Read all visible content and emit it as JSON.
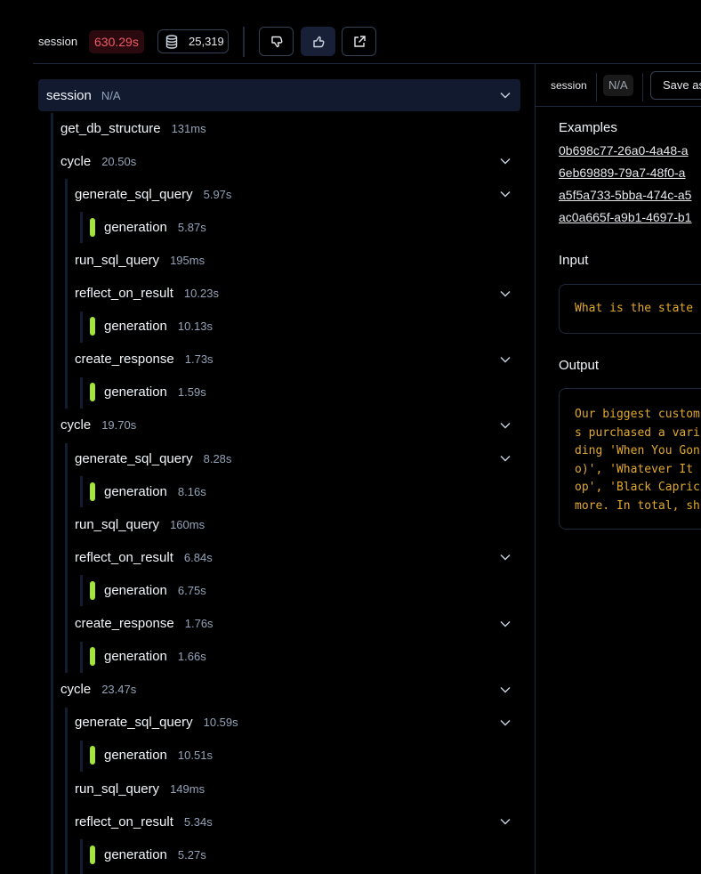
{
  "topbar": {
    "label": "session",
    "latency": "630.29s",
    "tokens": "25,319",
    "buttons": [
      {
        "icon": "thumbs-down-icon",
        "active": false
      },
      {
        "icon": "thumbs-up-icon",
        "active": true
      },
      {
        "icon": "external-link-icon",
        "active": false
      }
    ]
  },
  "colors": {
    "latency_text": "#f05a66",
    "generation_marker": "#a3e635",
    "code_text": "#e0a82e",
    "selected_row_bg": "#111a2e"
  },
  "tree": {
    "root": {
      "name": "session",
      "duration": "N/A"
    },
    "nodes": [
      {
        "name": "get_db_structure",
        "duration": "131ms",
        "level": 1,
        "expandable": false
      },
      {
        "name": "cycle",
        "duration": "20.50s",
        "level": 1,
        "expandable": true
      },
      {
        "name": "generate_sql_query",
        "duration": "5.97s",
        "level": 2,
        "expandable": true
      },
      {
        "name": "generation",
        "duration": "5.87s",
        "level": 3,
        "generation": true
      },
      {
        "name": "run_sql_query",
        "duration": "195ms",
        "level": 2,
        "expandable": false
      },
      {
        "name": "reflect_on_result",
        "duration": "10.23s",
        "level": 2,
        "expandable": true
      },
      {
        "name": "generation",
        "duration": "10.13s",
        "level": 3,
        "generation": true
      },
      {
        "name": "create_response",
        "duration": "1.73s",
        "level": 2,
        "expandable": true
      },
      {
        "name": "generation",
        "duration": "1.59s",
        "level": 3,
        "generation": true
      },
      {
        "name": "cycle",
        "duration": "19.70s",
        "level": 1,
        "expandable": true
      },
      {
        "name": "generate_sql_query",
        "duration": "8.28s",
        "level": 2,
        "expandable": true
      },
      {
        "name": "generation",
        "duration": "8.16s",
        "level": 3,
        "generation": true
      },
      {
        "name": "run_sql_query",
        "duration": "160ms",
        "level": 2,
        "expandable": false
      },
      {
        "name": "reflect_on_result",
        "duration": "6.84s",
        "level": 2,
        "expandable": true
      },
      {
        "name": "generation",
        "duration": "6.75s",
        "level": 3,
        "generation": true
      },
      {
        "name": "create_response",
        "duration": "1.76s",
        "level": 2,
        "expandable": true
      },
      {
        "name": "generation",
        "duration": "1.66s",
        "level": 3,
        "generation": true
      },
      {
        "name": "cycle",
        "duration": "23.47s",
        "level": 1,
        "expandable": true
      },
      {
        "name": "generate_sql_query",
        "duration": "10.59s",
        "level": 2,
        "expandable": true
      },
      {
        "name": "generation",
        "duration": "10.51s",
        "level": 3,
        "generation": true
      },
      {
        "name": "run_sql_query",
        "duration": "149ms",
        "level": 2,
        "expandable": false
      },
      {
        "name": "reflect_on_result",
        "duration": "5.34s",
        "level": 2,
        "expandable": true
      },
      {
        "name": "generation",
        "duration": "5.27s",
        "level": 3,
        "generation": true
      }
    ]
  },
  "detail": {
    "header": {
      "label": "session",
      "value": "N/A",
      "save_label": "Save as"
    },
    "examples_title": "Examples",
    "examples": [
      "0b698c77-26a0-4a48-a",
      "6eb69889-79a7-48f0-a",
      "a5f5a733-5bba-474c-a5",
      "ac0a665f-a9b1-4697-b1"
    ],
    "input_title": "Input",
    "input_text": "What is the state",
    "output_title": "Output",
    "output_lines": [
      "Our biggest custom",
      "s purchased a vari",
      "ding 'When You Gon",
      "o)', 'Whatever It ",
      "op', 'Black Capric",
      "more. In total, sh"
    ]
  }
}
